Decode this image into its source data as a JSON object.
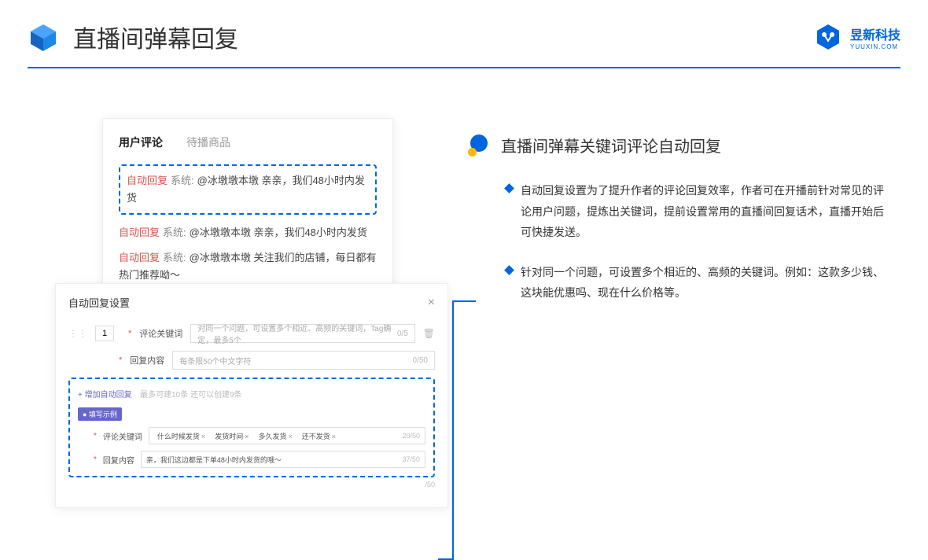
{
  "header": {
    "title": "直播间弹幕回复",
    "brand_name": "昱新科技",
    "brand_sub": "YUUXIN.COM"
  },
  "upper": {
    "tab1": "用户评论",
    "tab2": "待播商品",
    "auto": "自动回复",
    "sys": "系统:",
    "msg1": "@冰墩墩本墩 亲亲，我们48小时内发货",
    "msg2": "@冰墩墩本墩 亲亲，我们48小时内发货",
    "msg3": "@冰墩墩本墩 关注我们的店铺，每日都有热门推荐呦～"
  },
  "lower": {
    "title": "自动回复设置",
    "num": "1",
    "kw_label": "评论关键词",
    "kw_placeholder": "对同一个问题，可设置多个相近、高频的关键词，Tag确定，最多5个",
    "kw_count": "0/5",
    "rc_label": "回复内容",
    "rc_placeholder": "每条限50个中文字符",
    "rc_count": "0/50",
    "add": "+ 增加自动回复",
    "add_hint": "最多可建10条 还可以创建9条",
    "ex_badge": "● 填写示例",
    "ex_kw": "评论关键词",
    "ex_kw_count": "20/50",
    "tag1": "什么时候发货",
    "tag2": "发货时间",
    "tag3": "多久发货",
    "tag4": "还不发货",
    "ex_rc": "回复内容",
    "ex_rc_text": "亲，我们这边都是下单48小时内发货的哦～",
    "ex_rc_count": "37/50",
    "ext_count": "/50"
  },
  "right": {
    "sec_title": "直播间弹幕关键词评论自动回复",
    "b1": "自动回复设置为了提升作者的评论回复效率，作者可在开播前针对常见的评论用户问题，提炼出关键词，提前设置常用的直播间回复话术，直播开始后可快捷发送。",
    "b2": "针对同一个问题，可设置多个相近的、高频的关键词。例如：这款多少钱、这块能优惠吗、现在什么价格等。"
  }
}
